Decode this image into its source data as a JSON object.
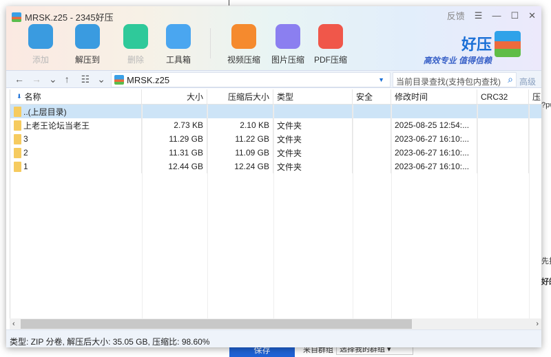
{
  "window": {
    "title": "MRSK.z25 - 2345好压",
    "feedback": "反馈"
  },
  "toolbar": [
    {
      "label": "添加",
      "icon": "add-icon",
      "disabled": true,
      "color": "#3a9be0"
    },
    {
      "label": "解压到",
      "icon": "extract-icon",
      "disabled": false,
      "color": "#3a9be0"
    },
    {
      "label": "删除",
      "icon": "delete-icon",
      "disabled": true,
      "color": "#2fc99a"
    },
    {
      "label": "工具箱",
      "icon": "toolbox-icon",
      "disabled": false,
      "color": "#4aa6f0"
    },
    {
      "label": "视频压缩",
      "icon": "video-compress-icon",
      "disabled": false,
      "color": "#f58a2e"
    },
    {
      "label": "图片压缩",
      "icon": "image-compress-icon",
      "disabled": false,
      "color": "#8b7ff0"
    },
    {
      "label": "PDF压缩",
      "icon": "pdf-compress-icon",
      "disabled": false,
      "color": "#f0574a"
    }
  ],
  "logo": {
    "name": "好压",
    "slogan": "高效专业  值得信赖"
  },
  "address": {
    "path": "MRSK.z25"
  },
  "search": {
    "placeholder": "当前目录查找(支持包内查找)",
    "advanced": "高级"
  },
  "columns": [
    "名称",
    "大小",
    "压缩后大小",
    "类型",
    "安全",
    "修改时间",
    "CRC32",
    "压"
  ],
  "rows": [
    {
      "name": "..(上层目录)",
      "size": "",
      "packed": "",
      "type": "",
      "security": "",
      "modified": "",
      "crc": ""
    },
    {
      "name": "上老王论坛当老王",
      "size": "2.73 KB",
      "packed": "2.10 KB",
      "type": "文件夹",
      "security": "",
      "modified": "2025-08-25 12:54:...",
      "crc": ""
    },
    {
      "name": "3",
      "size": "11.29 GB",
      "packed": "11.22 GB",
      "type": "文件夹",
      "security": "",
      "modified": "2023-06-27 16:10:...",
      "crc": ""
    },
    {
      "name": "2",
      "size": "11.31 GB",
      "packed": "11.09 GB",
      "type": "文件夹",
      "security": "",
      "modified": "2023-06-27 16:10:...",
      "crc": ""
    },
    {
      "name": "1",
      "size": "12.44 GB",
      "packed": "12.24 GB",
      "type": "文件夹",
      "security": "",
      "modified": "2023-06-27 16:10:...",
      "crc": ""
    }
  ],
  "status": "类型: ZIP 分卷, 解压后大小: 35.05 GB, 压缩比: 98.60%",
  "background": {
    "save": "保存",
    "group_label": "来自群组",
    "group_select": "选择我的群组",
    "right_texts": [
      "?pw",
      "先择",
      "好的"
    ]
  }
}
